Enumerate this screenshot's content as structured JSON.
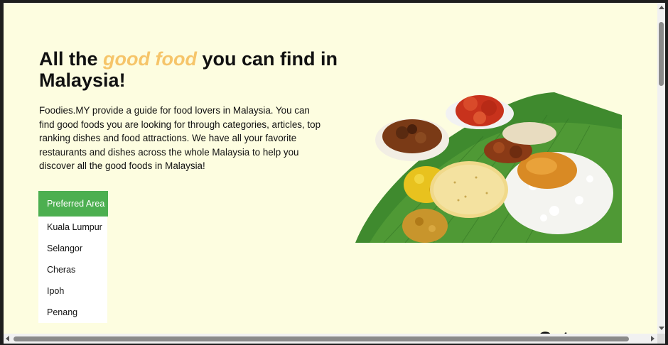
{
  "hero": {
    "title_before": "All the ",
    "title_accent": "good food",
    "title_after": " you can find in Malaysia!",
    "description": "Foodies.MY provide a guide for food lovers in Malaysia. You can find good foods you are looking for through categories, articles, top ranking dishes and food attractions. We have all your favorite restaurants and dishes across the whole Malaysia to help you discover all the good foods in Malaysia!",
    "image_icon": "nasi-banana-leaf-photo"
  },
  "area_menu": {
    "header": "Preferred Area",
    "items": [
      {
        "label": "Kuala Lumpur"
      },
      {
        "label": "Selangor"
      },
      {
        "label": "Cheras"
      },
      {
        "label": "Ipoh"
      },
      {
        "label": "Penang"
      }
    ]
  },
  "section": {
    "category_heading": "Category"
  },
  "colors": {
    "page_background": "#fdfde0",
    "accent": "#f6c56a",
    "menu_header": "#4caf50"
  }
}
